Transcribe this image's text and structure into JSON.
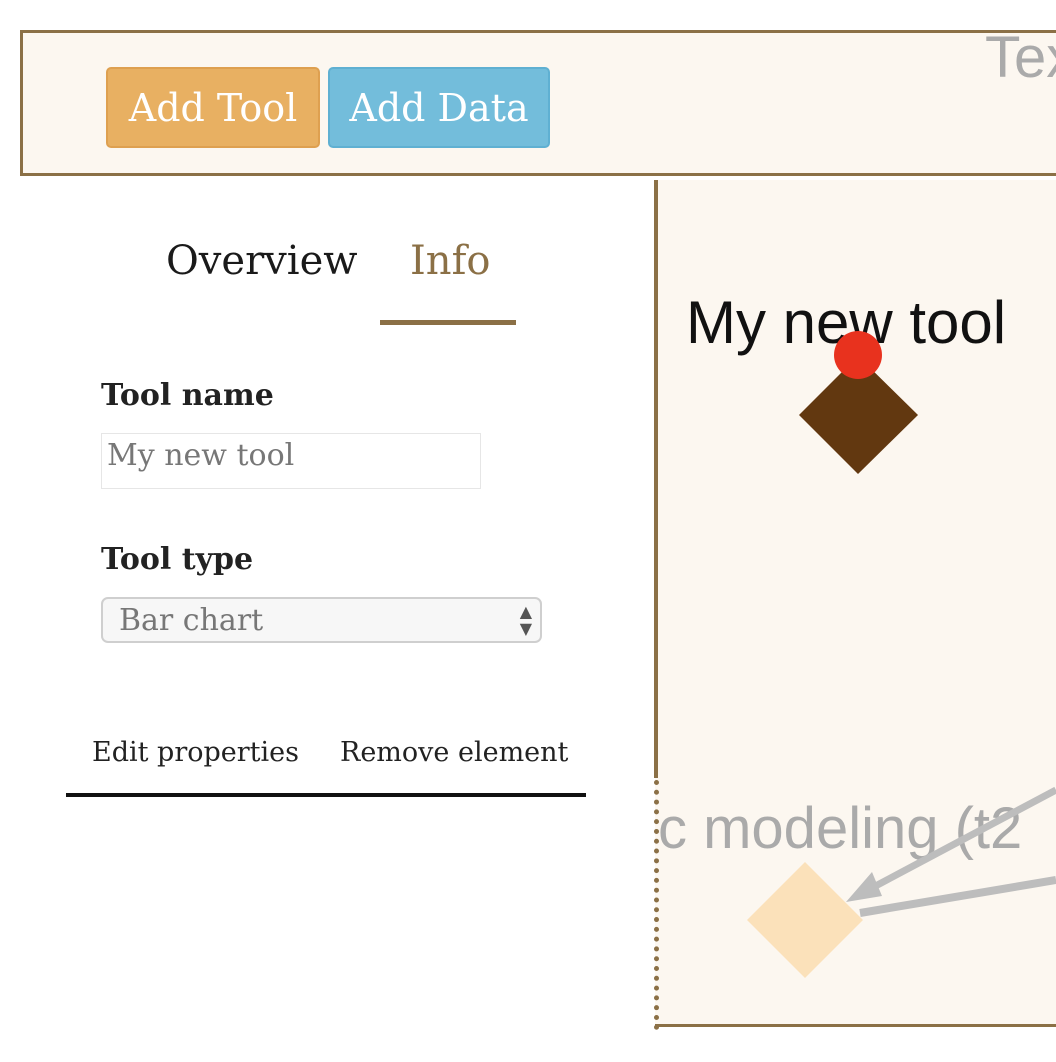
{
  "toolbar": {
    "add_tool_label": "Add Tool",
    "add_data_label": "Add Data",
    "corner_text": "Tex"
  },
  "tabs": [
    {
      "label": "Overview",
      "active": false
    },
    {
      "label": "Info",
      "active": true
    }
  ],
  "form": {
    "tool_name_label": "Tool name",
    "tool_name_value": "My new tool",
    "tool_type_label": "Tool type",
    "tool_type_selected": "Bar chart"
  },
  "actions": {
    "edit_label": "Edit properties",
    "remove_label": "Remove element"
  },
  "canvas": {
    "selected_node_title": "My new tool",
    "faded_node_title": "c modeling (t2"
  },
  "colors": {
    "accent": "#8b7046",
    "add_tool": "#e8b062",
    "add_data": "#73bddb",
    "node_selected": "#623810",
    "node_handle": "#e8321e",
    "node_faded": "#fbe1ba",
    "edge": "#bdbdbd"
  }
}
